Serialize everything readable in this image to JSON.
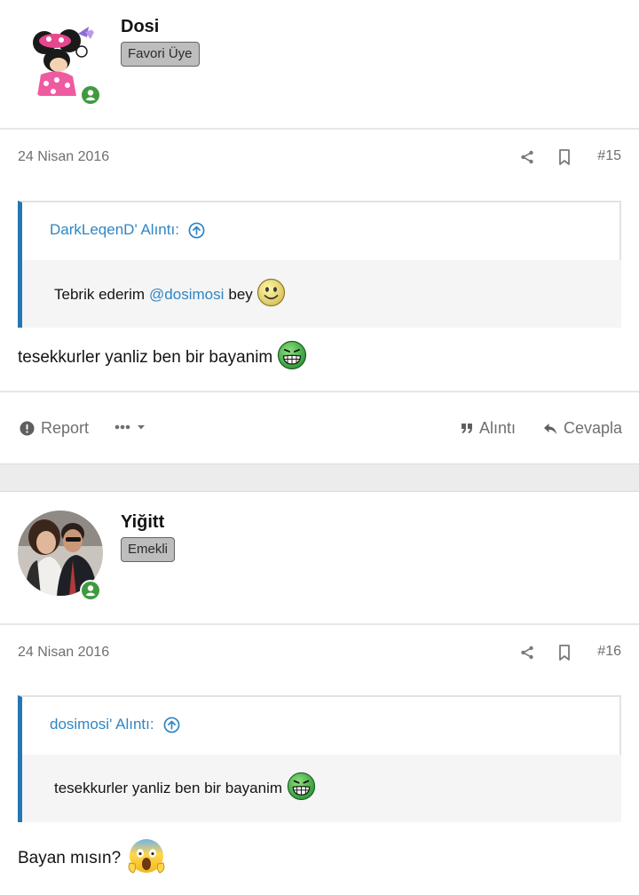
{
  "posts": [
    {
      "username": "Dosi",
      "badge": "Favori Üye",
      "date": "24 Nisan 2016",
      "post_number": "#15",
      "quote": {
        "author": "DarkLeqenD' Alıntı:",
        "text_before": "Tebrik ederim",
        "mention": "@dosimosi",
        "text_after": "bey",
        "emoji": "smile"
      },
      "body": "tesekkurler yanliz ben bir bayanim",
      "body_emoji": "grin",
      "actions": {
        "report": "Report",
        "quote": "Alıntı",
        "reply": "Cevapla"
      }
    },
    {
      "username": "Yiğitt",
      "badge": "Emekli",
      "date": "24 Nisan 2016",
      "post_number": "#16",
      "quote": {
        "author": "dosimosi' Alıntı:",
        "text": "tesekkurler yanliz ben bir bayanim",
        "emoji": "grin"
      },
      "body": "Bayan mısın?",
      "body_emoji": "scream"
    }
  ],
  "colors": {
    "accent": "#2f86c4",
    "quote_bar": "#2577b1",
    "muted": "#6f6f6f",
    "online": "#3f9a3f"
  }
}
